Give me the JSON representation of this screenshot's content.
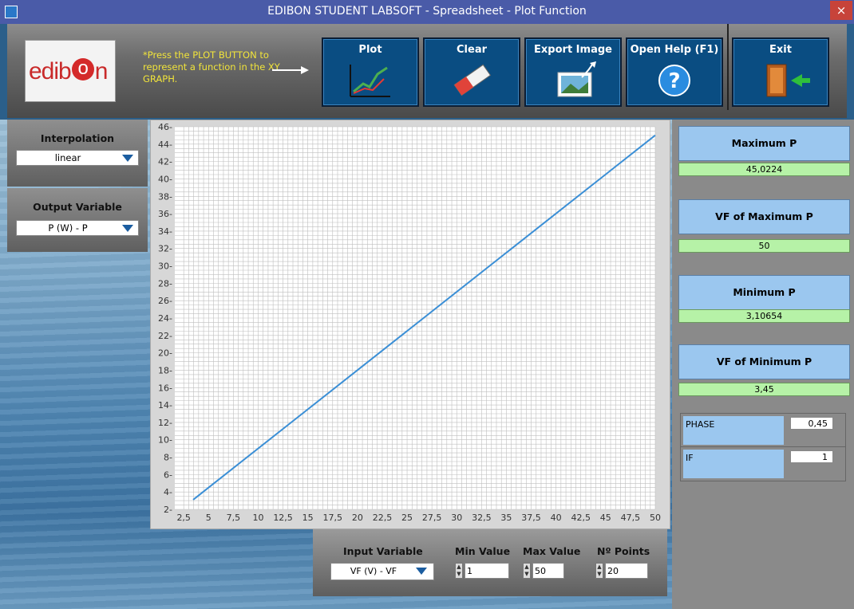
{
  "window": {
    "title": "EDIBON STUDENT LABSOFT - Spreadsheet - Plot Function",
    "close_glyph": "×"
  },
  "logo": {
    "pre": "edib",
    "o": "o",
    "post": "n"
  },
  "toolbar": {
    "hint": "*Press the PLOT BUTTON to represent a function in the XY GRAPH.",
    "buttons": [
      {
        "label": "Plot",
        "icon": "plot-chart-icon"
      },
      {
        "label": "Clear",
        "icon": "eraser-icon"
      },
      {
        "label": "Export Image",
        "icon": "export-image-icon"
      },
      {
        "label": "Open Help (F1)",
        "icon": "help-icon"
      },
      {
        "label": "Exit",
        "icon": "exit-door-icon"
      }
    ]
  },
  "left": {
    "interpolation": {
      "label": "Interpolation",
      "value": "linear"
    },
    "output": {
      "label": "Output Variable",
      "value": "P (W) - P"
    }
  },
  "right": {
    "max_p": {
      "label": "Maximum P",
      "value": "45,0224"
    },
    "vf_max": {
      "label": "VF of Maximum P",
      "value": "50"
    },
    "min_p": {
      "label": "Minimum P",
      "value": "3,10654"
    },
    "vf_min": {
      "label": "VF of Minimum P",
      "value": "3,45"
    },
    "phase": {
      "label": "PHASE",
      "value": "0,45"
    },
    "if": {
      "label": "IF",
      "value": "1"
    }
  },
  "bottom": {
    "input": {
      "label": "Input Variable",
      "value": "VF (V) - VF"
    },
    "min": {
      "label": "Min Value",
      "value": "1"
    },
    "max": {
      "label": "Max Value",
      "value": "50"
    },
    "points": {
      "label": "Nº Points",
      "value": "20"
    }
  },
  "colors": {
    "line": "#3b8fd6",
    "accent_button": "#0a4d82",
    "value_green": "#b6f2a7",
    "label_blue": "#9bc7ef"
  },
  "chart_data": {
    "type": "line",
    "x_ticks": [
      "2,5",
      "5",
      "7,5",
      "10",
      "12,5",
      "15",
      "17,5",
      "20",
      "22,5",
      "25",
      "27,5",
      "30",
      "32,5",
      "35",
      "37,5",
      "40",
      "42,5",
      "45",
      "47,5",
      "50"
    ],
    "y_ticks": [
      "2",
      "4",
      "6",
      "8",
      "10",
      "12",
      "14",
      "16",
      "18",
      "20",
      "22",
      "24",
      "26",
      "28",
      "30",
      "32",
      "34",
      "36",
      "38",
      "40",
      "42",
      "44",
      "46"
    ],
    "xlim": [
      1.6,
      50
    ],
    "ylim": [
      2,
      46
    ],
    "grid": true,
    "series": [
      {
        "x": [
          3.45,
          50
        ],
        "y": [
          3.10654,
          45.0224
        ]
      }
    ]
  }
}
